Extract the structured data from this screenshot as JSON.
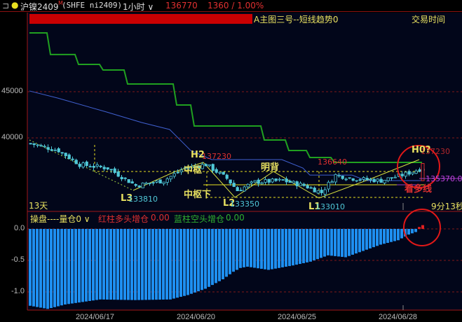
{
  "header": {
    "symbol": "沪镍2409",
    "flag": "M",
    "code": "(SHFE ni2409)",
    "period": "1小时",
    "price": "136770",
    "change": "1360 / 1.00%"
  },
  "main": {
    "indicator_name": "A主图三号--短线趋势0",
    "right_label": "交易时间",
    "days": "13天",
    "countdown": "9分13秒",
    "y_ticks": [
      "45000",
      "40000"
    ],
    "labels": {
      "h2": "H2",
      "h2_price": "137230",
      "zhongshu": "中枢",
      "zhongshu_low": "中枢下",
      "divergence": "明背",
      "l2": "L2",
      "l2_price": "133350",
      "l3": "L3",
      "l3_price": "133810",
      "l1": "L1",
      "l1_price": "133010",
      "mid_price": "136640",
      "h0": "H0?",
      "h0_price": "137230",
      "last_price": "135370.0",
      "watch_long": "看多线"
    }
  },
  "sub": {
    "title": "操盘----量仓0",
    "red_label": "红柱多头增仓",
    "red_value": "0.00",
    "blue_label": "蓝柱空头增仓",
    "blue_value": "0.00",
    "y_ticks": [
      "0.0",
      "-0.5",
      "-1.0"
    ]
  },
  "x_ticks": [
    "2024/06/17",
    "2024/06/20",
    "2024/06/25",
    "2024/06/28"
  ],
  "colors": {
    "up": "#50c8d8",
    "down": "#0a9a9a",
    "green_line": "#20a020",
    "blue_line": "#4060d0",
    "bar_blue": "#1e8ff0",
    "bar_red": "#e02020",
    "accent": "#e03030"
  },
  "chart_data": {
    "type": "candlestick+bar",
    "close_keypoints": [
      [
        0,
        139390
      ],
      [
        8,
        138640
      ],
      [
        14,
        137120
      ],
      [
        22,
        136740
      ],
      [
        30,
        134850
      ],
      [
        38,
        135380
      ],
      [
        44,
        136740
      ],
      [
        50,
        137120
      ],
      [
        56,
        135610
      ],
      [
        59,
        134320
      ],
      [
        64,
        135230
      ],
      [
        72,
        135380
      ],
      [
        78,
        134850
      ],
      [
        83,
        134090
      ],
      [
        87,
        135980
      ],
      [
        92,
        135610
      ],
      [
        100,
        135380
      ],
      [
        106,
        135980
      ],
      [
        112,
        136740
      ]
    ],
    "green_line": [
      [
        0,
        151360
      ],
      [
        5,
        151360
      ],
      [
        6,
        149020
      ],
      [
        13,
        149020
      ],
      [
        14,
        147950
      ],
      [
        20,
        147950
      ],
      [
        21,
        147350
      ],
      [
        27,
        147350
      ],
      [
        28,
        145830
      ],
      [
        41,
        145830
      ],
      [
        42,
        143560
      ],
      [
        46,
        143560
      ],
      [
        47,
        141290
      ],
      [
        66,
        141290
      ],
      [
        67,
        139770
      ],
      [
        73,
        139770
      ],
      [
        74,
        138640
      ],
      [
        79,
        138640
      ],
      [
        80,
        137880
      ],
      [
        86,
        137880
      ],
      [
        87,
        137350
      ],
      [
        112,
        137350
      ]
    ],
    "blue_line": [
      [
        0,
        145080
      ],
      [
        8,
        144320
      ],
      [
        22,
        142800
      ],
      [
        32,
        141670
      ],
      [
        40,
        140910
      ],
      [
        46,
        138640
      ],
      [
        52,
        137650
      ],
      [
        72,
        137650
      ],
      [
        78,
        136740
      ],
      [
        80,
        135980
      ],
      [
        92,
        135980
      ],
      [
        96,
        135380
      ],
      [
        112,
        135380
      ]
    ],
    "position_keypoints": [
      [
        0,
        -1.22
      ],
      [
        5,
        -1.27
      ],
      [
        10,
        -1.2
      ],
      [
        20,
        -1.12
      ],
      [
        30,
        -1.13
      ],
      [
        40,
        -1.12
      ],
      [
        45,
        -1.05
      ],
      [
        50,
        -0.95
      ],
      [
        55,
        -0.8
      ],
      [
        58,
        -0.68
      ],
      [
        60,
        -0.62
      ],
      [
        62,
        -0.6
      ],
      [
        68,
        -0.65
      ],
      [
        75,
        -0.58
      ],
      [
        80,
        -0.52
      ],
      [
        85,
        -0.42
      ],
      [
        90,
        -0.45
      ],
      [
        95,
        -0.35
      ],
      [
        100,
        -0.25
      ],
      [
        105,
        -0.18
      ],
      [
        108,
        -0.09
      ],
      [
        110,
        -0.05
      ],
      [
        111,
        0.03
      ],
      [
        112,
        0.06
      ]
    ]
  }
}
